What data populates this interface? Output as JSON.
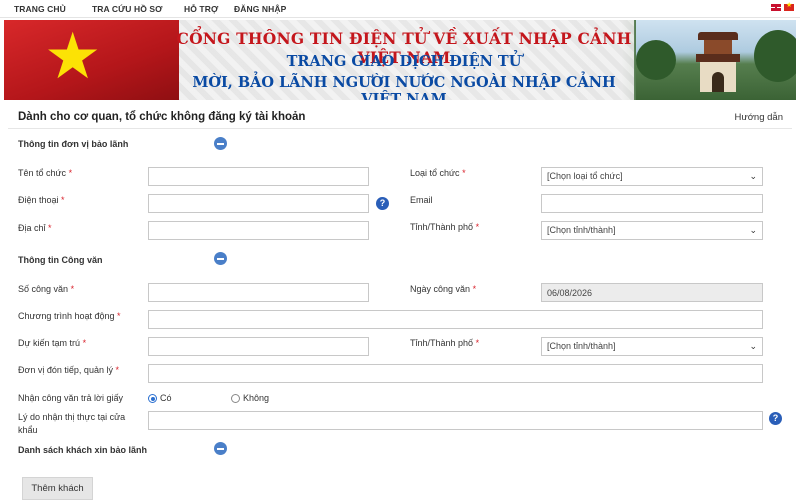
{
  "nav": {
    "items": [
      "TRANG CHỦ",
      "TRA CỨU HỒ SƠ",
      "HỖ TRỢ",
      "ĐĂNG NHẬP"
    ]
  },
  "banner": {
    "title_line1": "CỔNG THÔNG TIN ĐIỆN TỬ VỀ XUẤT NHẬP CẢNH VIỆT NAM",
    "title_line2": "TRANG GIAO DỊCH ĐIỆN TỬ",
    "title_line3": "MỜI, BẢO LÃNH NGƯỜI NƯỚC NGOÀI NHẬP CẢNH VIỆT NAM"
  },
  "page": {
    "title": "Dành cho cơ quan, tổ chức không đăng ký tài khoản",
    "help": "Hướng dẫn"
  },
  "sections": {
    "guarantor": "Thông tin đơn vị bảo lãnh",
    "document": "Thông tin Công văn",
    "guests": "Danh sách khách xin bảo lãnh"
  },
  "fields": {
    "org_name": {
      "label": "Tên tổ chức",
      "value": ""
    },
    "org_type": {
      "label": "Loại tổ chức",
      "value": "[Chọn loại tổ chức]"
    },
    "phone": {
      "label": "Điện thoại",
      "value": ""
    },
    "email": {
      "label": "Email",
      "value": ""
    },
    "address": {
      "label": "Địa chỉ",
      "value": ""
    },
    "province1": {
      "label": "Tỉnh/Thành phố",
      "value": "[Chọn tỉnh/thành]"
    },
    "doc_number": {
      "label": "Số công văn",
      "value": ""
    },
    "doc_date": {
      "label": "Ngày công văn",
      "value": "06/08/2026"
    },
    "program": {
      "label": "Chương trình hoạt động",
      "value": ""
    },
    "temp_stay": {
      "label": "Dự kiến tạm trú",
      "value": ""
    },
    "province2": {
      "label": "Tỉnh/Thành phố",
      "value": "[Chọn tỉnh/thành]"
    },
    "host_unit": {
      "label": "Đơn vị đón tiếp, quản lý",
      "value": ""
    },
    "paper_reply": {
      "label": "Nhận công văn trả lời giấy",
      "option_yes": "Có",
      "option_no": "Không",
      "selected": "Có"
    },
    "visa_reason": {
      "label_line1": "Lý do nhận thị thực tại cửa",
      "label_line2": "khẩu",
      "value": ""
    }
  },
  "required_mark": "*",
  "help_glyph": "?",
  "buttons": {
    "add_guest": "Thêm khách"
  }
}
